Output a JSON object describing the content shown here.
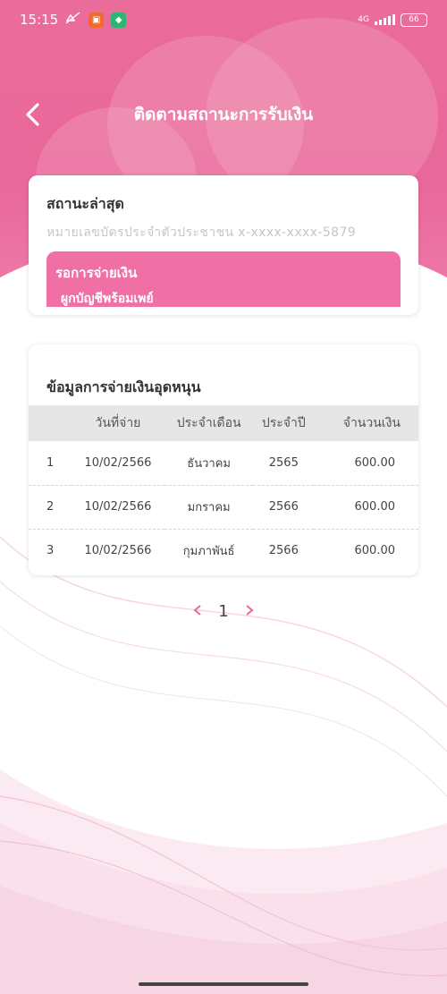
{
  "status_bar": {
    "time": "15:15",
    "network": "4G",
    "battery": "66"
  },
  "header": {
    "title": "ติดตามสถานะการรับเงิน"
  },
  "status_card": {
    "title": "สถานะล่าสุด",
    "id_line": "หมายเลขบัตรประจำตัวประชาชน x-xxxx-xxxx-5879",
    "pill_main": "รอการจ่ายเงิน",
    "pill_sub": "ผูกบัญชีพร้อมเพย์"
  },
  "payment_card": {
    "title": "ข้อมูลการจ่ายเงินอุดหนุน",
    "columns": [
      "",
      "วันที่จ่าย",
      "ประจำเดือน",
      "ประจำปี",
      "จำนวนเงิน"
    ],
    "rows": [
      {
        "no": "1",
        "date": "10/02/2566",
        "month": "ธันวาคม",
        "year": "2565",
        "amount": "600.00"
      },
      {
        "no": "2",
        "date": "10/02/2566",
        "month": "มกราคม",
        "year": "2566",
        "amount": "600.00"
      },
      {
        "no": "3",
        "date": "10/02/2566",
        "month": "กุมภาพันธ์",
        "year": "2566",
        "amount": "600.00"
      }
    ]
  },
  "pagination": {
    "current_page": "1",
    "prev_icon": "chevron-left-icon",
    "next_icon": "chevron-right-icon"
  },
  "colors": {
    "brand_pink": "#ea6c9a",
    "pill_pink": "#f06fa4",
    "table_header_bg": "#e6e6e6"
  }
}
